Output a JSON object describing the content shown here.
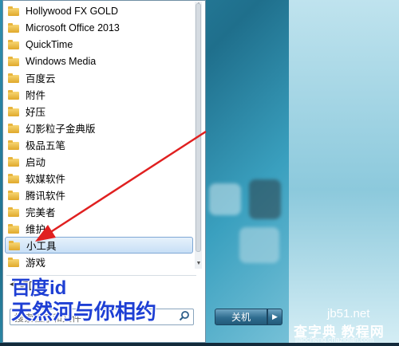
{
  "start_menu": {
    "programs": [
      {
        "label": "Hollywood FX GOLD",
        "selected": false
      },
      {
        "label": "Microsoft Office 2013",
        "selected": false
      },
      {
        "label": "QuickTime",
        "selected": false
      },
      {
        "label": "Windows Media",
        "selected": false
      },
      {
        "label": "百度云",
        "selected": false
      },
      {
        "label": "附件",
        "selected": false
      },
      {
        "label": "好压",
        "selected": false
      },
      {
        "label": "幻影粒子金典版",
        "selected": false
      },
      {
        "label": "极品五笔",
        "selected": false
      },
      {
        "label": "启动",
        "selected": false
      },
      {
        "label": "软媒软件",
        "selected": false
      },
      {
        "label": "腾讯软件",
        "selected": false
      },
      {
        "label": "完美者",
        "selected": false
      },
      {
        "label": "维护",
        "selected": false
      },
      {
        "label": "小工具",
        "selected": true
      },
      {
        "label": "游戏",
        "selected": false
      }
    ],
    "back_label": "返回",
    "search_placeholder": "搜索程序和文件"
  },
  "shutdown": {
    "label": "关机"
  },
  "watermark": {
    "line1": "百度id",
    "line2": "天然河与你相约",
    "site1": "jb51.net",
    "site2": "查字典 教程网",
    "site3": "jiaocheng.chazidian.com"
  },
  "colors": {
    "annotation_arrow": "#e02020",
    "watermark_text": "#1e3fd4",
    "selection": "#c7dff6"
  }
}
